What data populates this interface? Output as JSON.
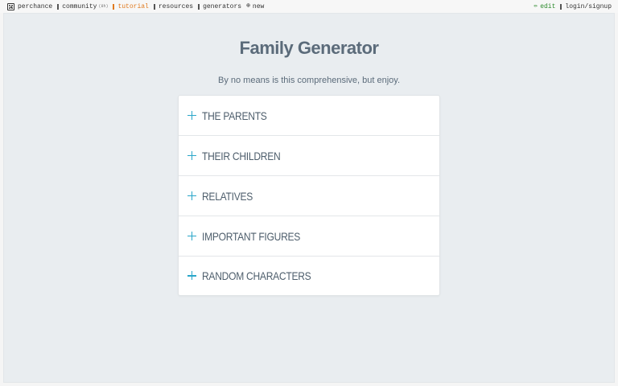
{
  "nav": {
    "brand": "perchance",
    "community": "community",
    "community_count": "(8h)",
    "tutorial": "tutorial",
    "resources": "resources",
    "generators": "generators",
    "new": "new",
    "edit": "edit",
    "login": "login/signup"
  },
  "page": {
    "title": "Family Generator",
    "subtitle": "By no means is this comprehensive, but enjoy."
  },
  "accordion": {
    "items": [
      {
        "label": "THE PARENTS"
      },
      {
        "label": "THEIR CHILDREN"
      },
      {
        "label": "RELATIVES"
      },
      {
        "label": "IMPORTANT FIGURES"
      },
      {
        "label": "RANDOM CHARACTERS"
      }
    ]
  },
  "colors": {
    "accent": "#2aa6c9",
    "title": "#5b6b7a",
    "tutorial": "#e07a1f",
    "edit": "#2e8b2e"
  }
}
